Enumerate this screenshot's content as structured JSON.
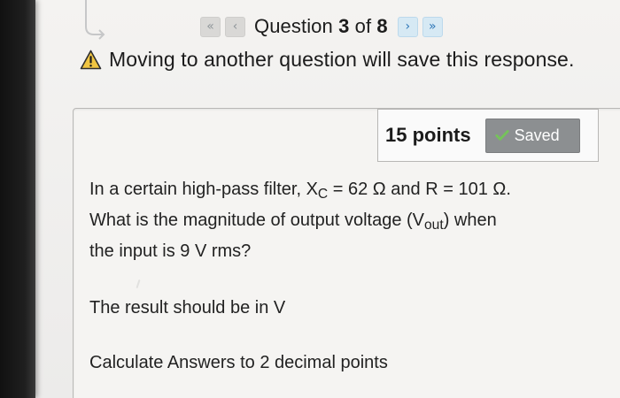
{
  "question_nav": {
    "first_button_icon": "double-chevron-left-icon",
    "prev_button_icon": "chevron-left-icon",
    "next_button_icon": "chevron-right-icon",
    "last_button_icon": "double-chevron-right-icon",
    "label_prefix": "Question",
    "current": "3",
    "of_label": "of",
    "total": "8"
  },
  "warning": {
    "icon": "warning-icon",
    "text": "Moving to another question will save this response."
  },
  "question": {
    "points": "15 points",
    "saved_label": "Saved",
    "saved_icon": "check-icon",
    "line1": {
      "pre": "In a certain high-pass filter, X",
      "sub": "C",
      "post": " = 62 Ω and R = 101 Ω."
    },
    "line2": {
      "pre": "What is the magnitude of output voltage (V",
      "sub": "out",
      "post": ") when"
    },
    "line3": "the input is 9 V rms?",
    "result_note": "The result should be in V",
    "decimal_note": "Calculate Answers to 2 decimal points"
  },
  "colors": {
    "nav_active": "#2d76b7",
    "saved_badge": "#8c8f91",
    "warning_fill": "#f0c542",
    "check_green": "#75c35a"
  }
}
